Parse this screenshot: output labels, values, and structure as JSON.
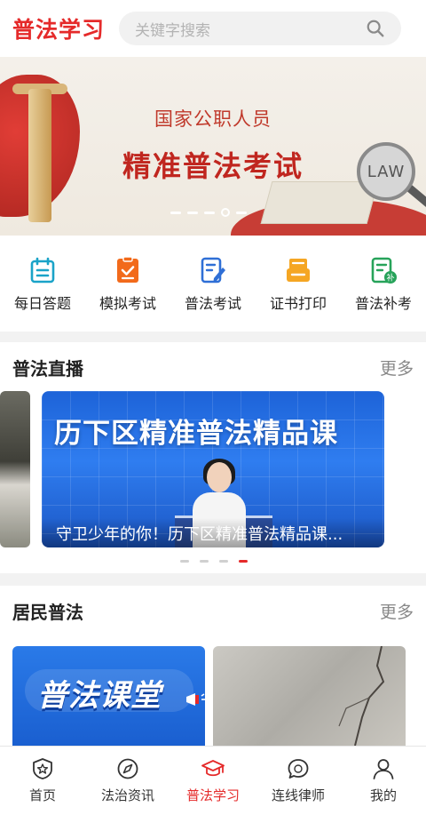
{
  "header": {
    "title": "普法学习",
    "search_placeholder": "关键字搜索"
  },
  "banner": {
    "line1": "国家公职人员",
    "line2": "精准普法考试",
    "badge": "LAW",
    "slide_count": 5,
    "active_slide": 4
  },
  "quick_menu": [
    {
      "label": "每日答题",
      "icon": "calendar-icon",
      "color": "#1aa3c8"
    },
    {
      "label": "模拟考试",
      "icon": "checklist-icon",
      "color": "#f26a1b"
    },
    {
      "label": "普法考试",
      "icon": "edit-document-icon",
      "color": "#2f6fd6"
    },
    {
      "label": "证书打印",
      "icon": "print-icon",
      "color": "#f5a623"
    },
    {
      "label": "普法补考",
      "icon": "makeup-exam-icon",
      "color": "#27a35a"
    }
  ],
  "live_section": {
    "title": "普法直播",
    "more": "更多",
    "card_headline": "历下区精准普法精品课",
    "card_caption": "守卫少年的你！历下区精准普法精品课...",
    "slide_count": 4,
    "active_slide": 4
  },
  "resident_section": {
    "title": "居民普法",
    "more": "更多",
    "card1_text": "普法课堂"
  },
  "bottom_nav": [
    {
      "label": "首页",
      "icon": "home-shield-icon",
      "active": false
    },
    {
      "label": "法治资讯",
      "icon": "compass-icon",
      "active": false
    },
    {
      "label": "普法学习",
      "icon": "graduation-cap-icon",
      "active": true
    },
    {
      "label": "连线律师",
      "icon": "chat-bubble-icon",
      "active": false
    },
    {
      "label": "我的",
      "icon": "user-icon",
      "active": false
    }
  ],
  "colors": {
    "brand_red": "#e52a2a",
    "text_dark": "#222222",
    "text_muted": "#888888"
  }
}
